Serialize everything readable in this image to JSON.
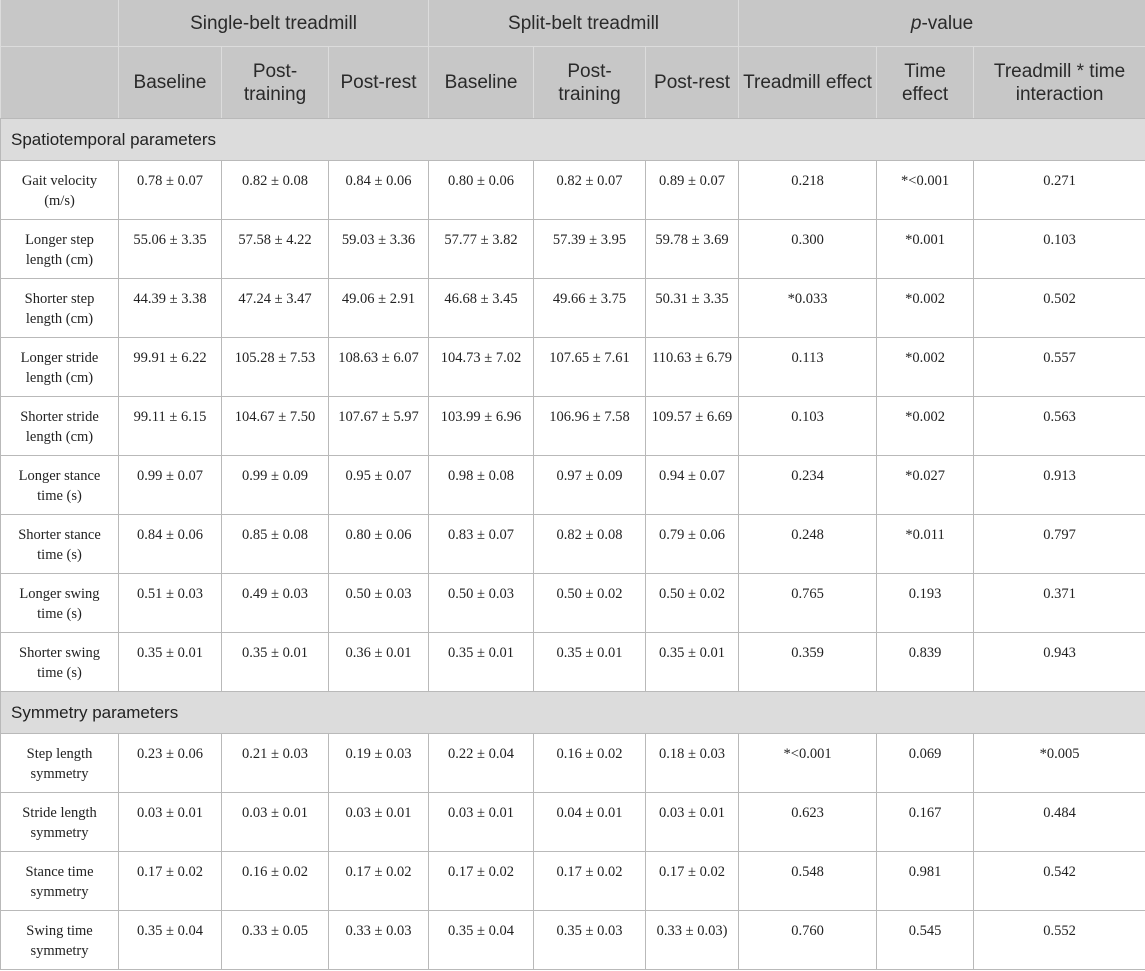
{
  "header": {
    "group_single": "Single-belt treadmill",
    "group_split": "Split-belt treadmill",
    "group_p_italic": "p",
    "group_p_rest": "-value",
    "sub": [
      "Baseline",
      "Post-training",
      "Post-rest",
      "Baseline",
      "Post-training",
      "Post-rest",
      "Treadmill effect",
      "Time effect",
      "Treadmill * time interaction"
    ]
  },
  "sections": [
    {
      "title": "Spatiotemporal parameters",
      "rows": [
        {
          "param": "Gait velocity (m/s)",
          "values": [
            "0.78 ± 0.07",
            "0.82 ± 0.08",
            "0.84 ± 0.06",
            "0.80 ± 0.06",
            "0.82 ± 0.07",
            "0.89 ± 0.07",
            "0.218",
            "*<0.001",
            "0.271"
          ]
        },
        {
          "param": "Longer step length (cm)",
          "values": [
            "55.06 ± 3.35",
            "57.58 ± 4.22",
            "59.03 ± 3.36",
            "57.77 ± 3.82",
            "57.39 ± 3.95",
            "59.78 ± 3.69",
            "0.300",
            "*0.001",
            "0.103"
          ]
        },
        {
          "param": "Shorter step length (cm)",
          "values": [
            "44.39 ± 3.38",
            "47.24 ± 3.47",
            "49.06 ± 2.91",
            "46.68 ± 3.45",
            "49.66 ± 3.75",
            "50.31 ± 3.35",
            "*0.033",
            "*0.002",
            "0.502"
          ]
        },
        {
          "param": "Longer stride length (cm)",
          "values": [
            "99.91 ± 6.22",
            "105.28 ± 7.53",
            "108.63 ± 6.07",
            "104.73 ± 7.02",
            "107.65 ± 7.61",
            "110.63 ± 6.79",
            "0.113",
            "*0.002",
            "0.557"
          ]
        },
        {
          "param": "Shorter stride length (cm)",
          "values": [
            "99.11 ± 6.15",
            "104.67 ± 7.50",
            "107.67 ± 5.97",
            "103.99 ± 6.96",
            "106.96 ± 7.58",
            "109.57 ± 6.69",
            "0.103",
            "*0.002",
            "0.563"
          ]
        },
        {
          "param": "Longer stance time (s)",
          "values": [
            "0.99 ± 0.07",
            "0.99 ± 0.09",
            "0.95 ± 0.07",
            "0.98 ± 0.08",
            "0.97 ± 0.09",
            "0.94 ± 0.07",
            "0.234",
            "*0.027",
            "0.913"
          ]
        },
        {
          "param": "Shorter stance time (s)",
          "values": [
            "0.84 ± 0.06",
            "0.85 ± 0.08",
            "0.80 ± 0.06",
            "0.83 ± 0.07",
            "0.82 ± 0.08",
            "0.79 ± 0.06",
            "0.248",
            "*0.011",
            "0.797"
          ]
        },
        {
          "param": "Longer swing time (s)",
          "values": [
            "0.51 ± 0.03",
            "0.49 ± 0.03",
            "0.50 ± 0.03",
            "0.50 ± 0.03",
            "0.50 ± 0.02",
            "0.50 ± 0.02",
            "0.765",
            "0.193",
            "0.371"
          ]
        },
        {
          "param": "Shorter swing time (s)",
          "values": [
            "0.35 ± 0.01",
            "0.35 ± 0.01",
            "0.36 ± 0.01",
            "0.35 ± 0.01",
            "0.35 ± 0.01",
            "0.35 ± 0.01",
            "0.359",
            "0.839",
            "0.943"
          ]
        }
      ]
    },
    {
      "title": "Symmetry parameters",
      "rows": [
        {
          "param": "Step length symmetry",
          "values": [
            "0.23 ± 0.06",
            "0.21 ± 0.03",
            "0.19 ± 0.03",
            "0.22 ± 0.04",
            "0.16 ± 0.02",
            "0.18 ± 0.03",
            "*<0.001",
            "0.069",
            "*0.005"
          ]
        },
        {
          "param": "Stride length symmetry",
          "values": [
            "0.03 ± 0.01",
            "0.03 ± 0.01",
            "0.03 ± 0.01",
            "0.03 ± 0.01",
            "0.04 ± 0.01",
            "0.03 ± 0.01",
            "0.623",
            "0.167",
            "0.484"
          ]
        },
        {
          "param": "Stance time symmetry",
          "values": [
            "0.17 ± 0.02",
            "0.16 ± 0.02",
            "0.17 ± 0.02",
            "0.17 ± 0.02",
            "0.17 ± 0.02",
            "0.17 ± 0.02",
            "0.548",
            "0.981",
            "0.542"
          ]
        },
        {
          "param": "Swing time symmetry",
          "values": [
            "0.35 ± 0.04",
            "0.33 ± 0.05",
            "0.33 ± 0.03",
            "0.35 ± 0.04",
            "0.35 ± 0.03",
            "0.33 ± 0.03)",
            "0.760",
            "0.545",
            "0.552"
          ]
        }
      ]
    }
  ]
}
